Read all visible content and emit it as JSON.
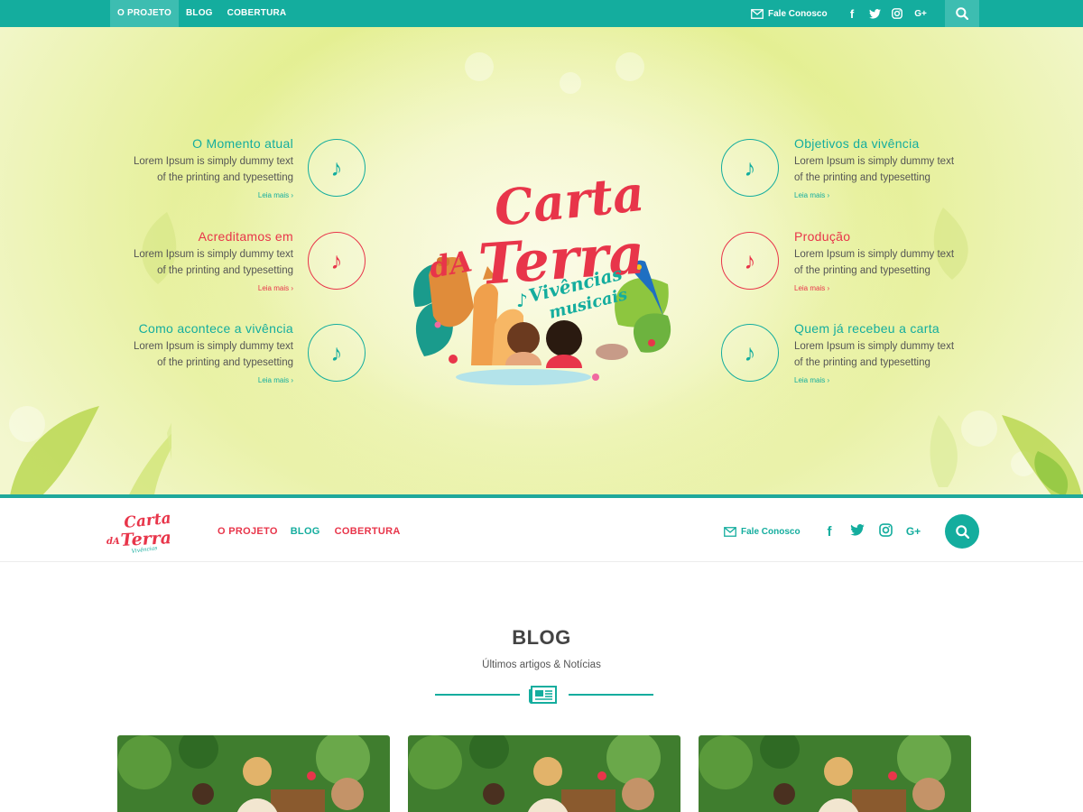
{
  "topbar": {
    "nav": [
      "O PROJETO",
      "BLOG",
      "COBERTURA"
    ],
    "contact": "Fale Conosco",
    "social": [
      "facebook-icon",
      "twitter-icon",
      "instagram-icon",
      "google-plus-icon"
    ],
    "social_glyphs": [
      "f",
      "t",
      "◎",
      "G+"
    ]
  },
  "hero": {
    "logo_text": {
      "line1": "Carta",
      "line2a": "dA",
      "line2b": "Terra",
      "tagline1": "Vivências",
      "tagline2": "musicais"
    },
    "features_left": [
      {
        "title": "O Momento atual",
        "text1": "Lorem Ipsum is simply dummy text",
        "text2": "of the printing and typesetting",
        "more": "Leia mais ›",
        "color": "#14ad9e"
      },
      {
        "title": "Acreditamos em",
        "text1": "Lorem Ipsum is simply dummy text",
        "text2": "of the printing and typesetting",
        "more": "Leia mais ›",
        "color": "#e8354a"
      },
      {
        "title": "Como acontece a vivência",
        "text1": "Lorem Ipsum is simply dummy text",
        "text2": "of the printing and typesetting",
        "more": "Leia mais ›",
        "color": "#14ad9e"
      }
    ],
    "features_right": [
      {
        "title": "Objetivos da vivência",
        "text1": "Lorem Ipsum is simply dummy text",
        "text2": "of the printing and typesetting",
        "more": "Leia mais ›",
        "color": "#14ad9e"
      },
      {
        "title": "Produção",
        "text1": "Lorem Ipsum is simply dummy text",
        "text2": "of the printing and typesetting",
        "more": "Leia mais ›",
        "color": "#e8354a"
      },
      {
        "title": "Quem já recebeu a carta",
        "text1": "Lorem Ipsum is simply dummy text",
        "text2": "of the printing and typesetting",
        "more": "Leia mais ›",
        "color": "#14ad9e"
      }
    ],
    "note_glyph": "♪"
  },
  "mainnav": {
    "links": [
      "O PROJETO",
      "BLOG",
      "COBERTURA"
    ],
    "contact": "Fale Conosco",
    "social_glyphs": [
      "f",
      "t",
      "◎",
      "G+"
    ]
  },
  "blog": {
    "title": "BLOG",
    "subtitle": "Últimos artigos & Notícias"
  },
  "colors": {
    "teal": "#14ad9e",
    "red": "#e8354a",
    "text": "#555555"
  }
}
